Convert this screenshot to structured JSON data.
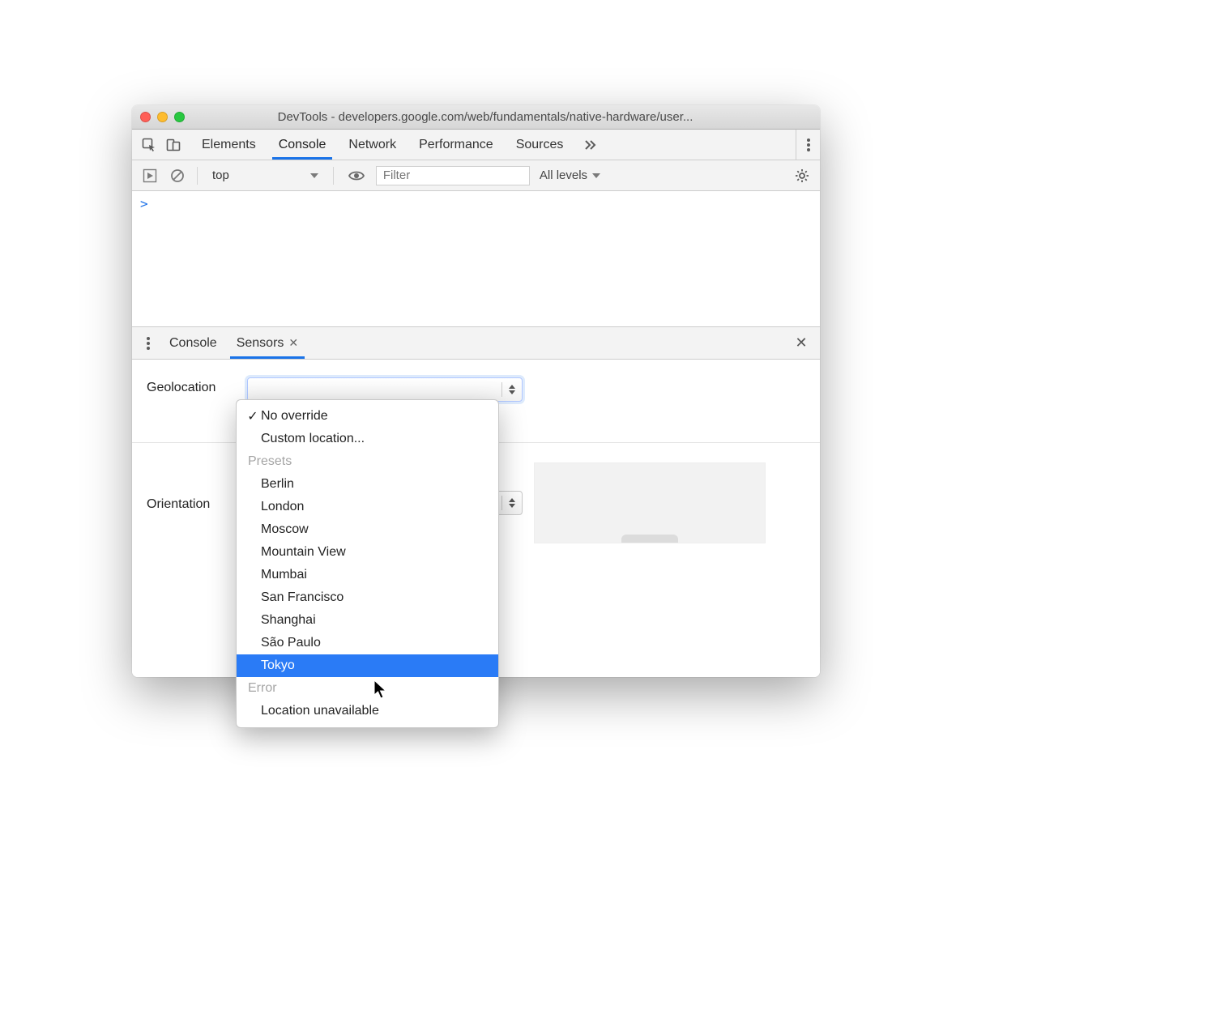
{
  "window": {
    "title": "DevTools - developers.google.com/web/fundamentals/native-hardware/user..."
  },
  "tabs": {
    "items": [
      "Elements",
      "Console",
      "Network",
      "Performance",
      "Sources"
    ],
    "active": "Console"
  },
  "console_toolbar": {
    "context": "top",
    "filter_placeholder": "Filter",
    "log_levels": "All levels"
  },
  "console": {
    "prompt": ">"
  },
  "drawer": {
    "tabs": [
      "Console",
      "Sensors"
    ],
    "active": "Sensors"
  },
  "sensors": {
    "geolocation_label": "Geolocation",
    "orientation_label": "Orientation"
  },
  "geolocation_dropdown": {
    "selected": "No override",
    "items": [
      {
        "label": "No override",
        "checked": true
      },
      {
        "label": "Custom location...",
        "checked": false
      }
    ],
    "presets_label": "Presets",
    "presets": [
      "Berlin",
      "London",
      "Moscow",
      "Mountain View",
      "Mumbai",
      "San Francisco",
      "Shanghai",
      "São Paulo",
      "Tokyo"
    ],
    "highlighted": "Tokyo",
    "error_label": "Error",
    "error_items": [
      "Location unavailable"
    ]
  }
}
